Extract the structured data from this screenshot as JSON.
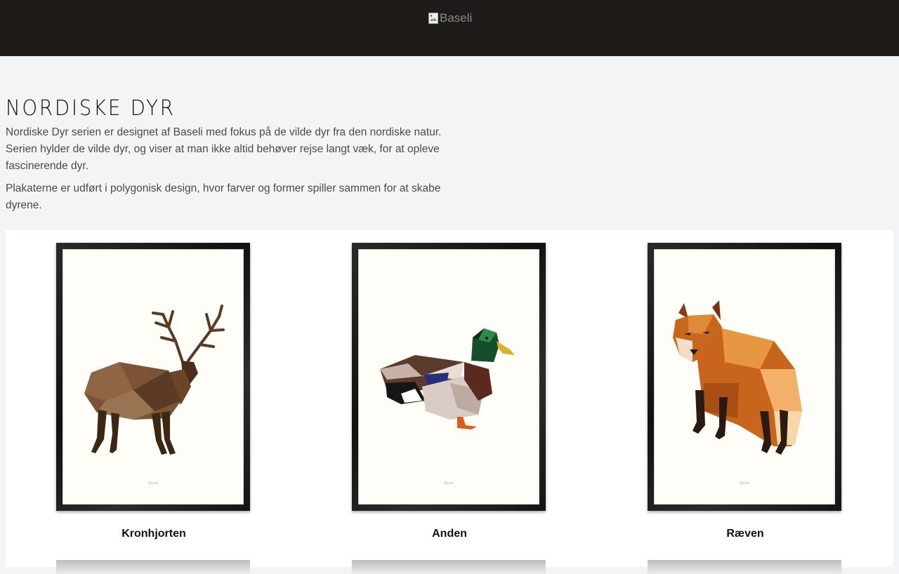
{
  "header": {
    "logo_alt": "Baseli"
  },
  "intro": {
    "title": "NORDISKE DYR",
    "paragraph1": "Nordiske Dyr serien er designet af Baseli med fokus på de vilde dyr fra den nordiske natur. Serien hylder de vilde dyr, og viser at man ikke altid behøver rejse langt væk, for at opleve fascinerende dyr.",
    "paragraph2": "Plakaterne er udført i polygonisk design, hvor farver og former spiller sammen for at skabe dyrene."
  },
  "products": [
    {
      "name": "Kronhjorten",
      "icon": "deer-poster-image",
      "watermark": "Baseli"
    },
    {
      "name": "Anden",
      "icon": "duck-poster-image",
      "watermark": "Baseli"
    },
    {
      "name": "Ræven",
      "icon": "fox-poster-image",
      "watermark": "Baseli"
    }
  ],
  "colors": {
    "header_bg": "#1e1a18",
    "page_bg": "#f3f4f6",
    "card_bg": "#ffffff"
  }
}
